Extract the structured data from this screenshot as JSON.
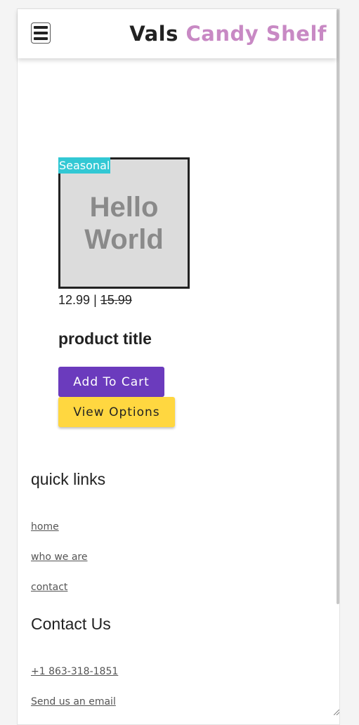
{
  "header": {
    "brand_part1": "Vals",
    "brand_part2": "Candy Shelf",
    "menu_icon": "hamburger-menu-icon"
  },
  "product": {
    "badge": "Seasonal",
    "image_text_line1": "Hello",
    "image_text_line2": "World",
    "price_current": "12.99",
    "price_separator": "|",
    "price_original": "15.99",
    "title": "product title",
    "add_to_cart_label": "Add To Cart",
    "view_options_label": "View Options"
  },
  "footer": {
    "quick_links_heading": "quick links",
    "links": [
      "home",
      "who we are",
      "contact"
    ],
    "contact_heading": "Contact Us",
    "phone": "+1 863-318-1851",
    "email_label": "Send us an email"
  },
  "colors": {
    "brand_accent": "#c889c4",
    "badge": "#32c8d4",
    "primary_button": "#6b3bbd",
    "secondary_button": "#ffd740"
  }
}
